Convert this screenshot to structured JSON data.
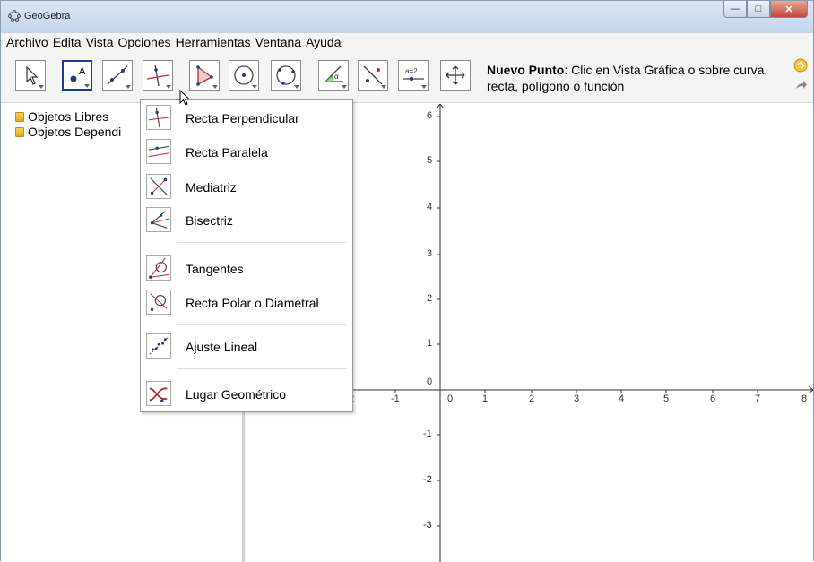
{
  "window": {
    "title": "GeoGebra"
  },
  "menu": [
    "Archivo",
    "Edita",
    "Vista",
    "Opciones",
    "Herramientas",
    "Ventana",
    "Ayuda"
  ],
  "toolbar": {
    "tools": [
      {
        "icon": "move-arrow-icon"
      },
      {
        "icon": "new-point-icon"
      },
      {
        "icon": "line-through-two-points-icon"
      },
      {
        "icon": "perpendicular-line-icon"
      },
      {
        "icon": "polygon-icon"
      },
      {
        "icon": "circle-center-point-icon"
      },
      {
        "icon": "circle-three-points-icon"
      },
      {
        "icon": "angle-icon"
      },
      {
        "icon": "reflect-icon"
      },
      {
        "icon": "slider-icon",
        "text": "a=2"
      },
      {
        "icon": "move-view-icon"
      }
    ],
    "help_title": "Nuevo Punto",
    "help_text": ": Clic en Vista Gráfica o sobre curva, recta, polígono o función"
  },
  "algebra": {
    "items": [
      "Objetos Libres",
      "Objetos Dependi"
    ]
  },
  "dropdown": {
    "items": [
      {
        "label": "Recta Perpendicular",
        "icon": "perpendicular-line-icon"
      },
      {
        "label": "Recta Paralela",
        "icon": "parallel-line-icon"
      },
      {
        "label": "Mediatriz",
        "icon": "perpendicular-bisector-icon"
      },
      {
        "label": "Bisectriz",
        "icon": "angle-bisector-icon"
      },
      {
        "label": "Tangentes",
        "icon": "tangents-icon"
      },
      {
        "label": "Recta Polar o Diametral",
        "icon": "polar-line-icon"
      },
      {
        "label": "Ajuste Lineal",
        "icon": "best-fit-line-icon"
      },
      {
        "label": "Lugar Geométrico",
        "icon": "locus-icon"
      }
    ]
  },
  "graphics": {
    "x_ticks": [
      "-1",
      "0",
      "1",
      "2",
      "3",
      "4",
      "5",
      "6",
      "7",
      "8"
    ],
    "x_tick_partial": "2",
    "y_ticks": [
      "6",
      "5",
      "4",
      "3",
      "2",
      "1",
      "0",
      "-1",
      "-2",
      "-3"
    ]
  }
}
